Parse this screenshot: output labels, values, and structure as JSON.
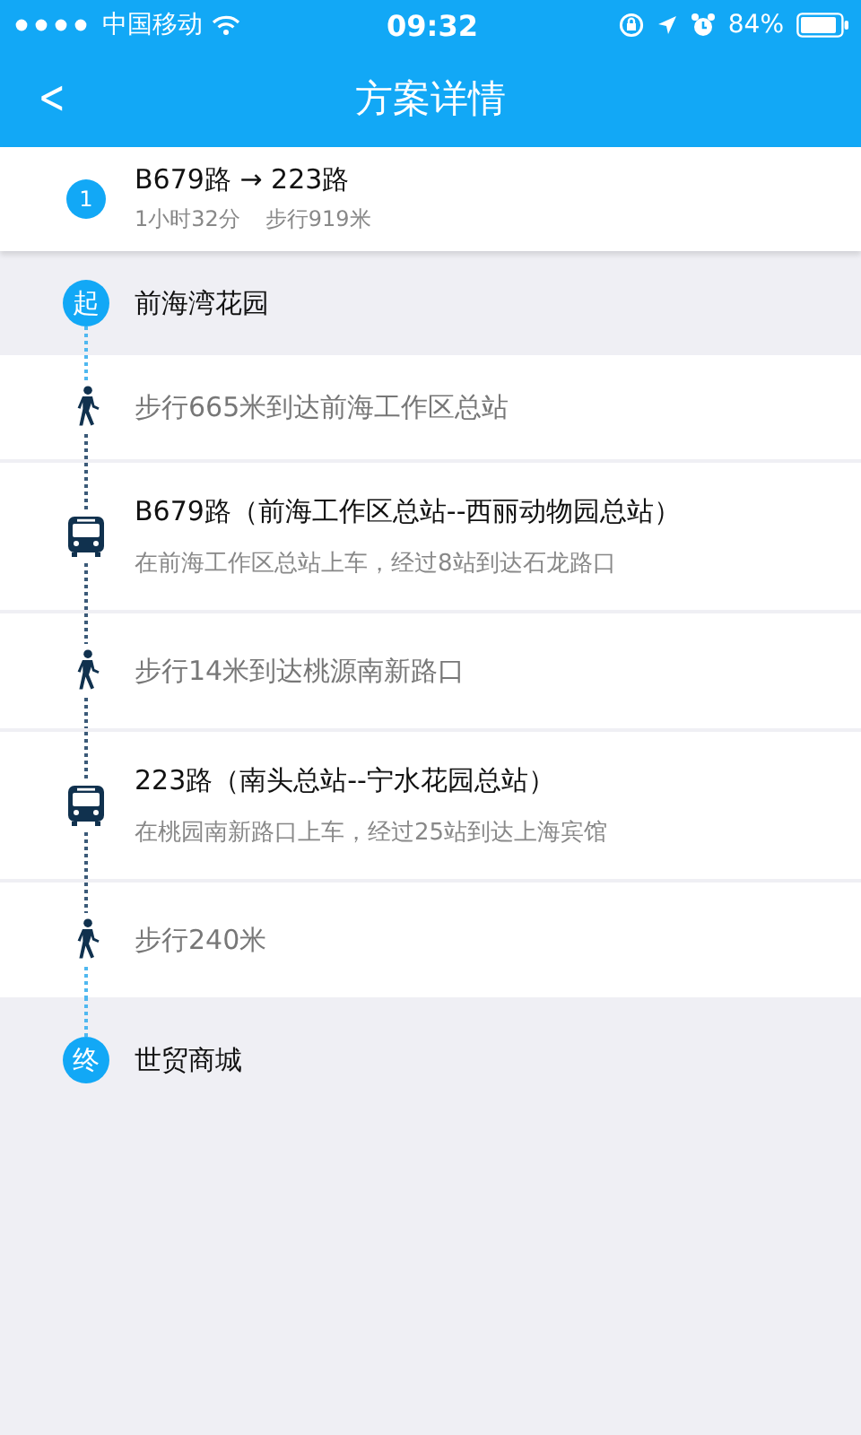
{
  "status_bar": {
    "carrier": "中国移动",
    "time": "09:32",
    "battery": "84%"
  },
  "nav": {
    "back": "<",
    "title": "方案详情"
  },
  "summary": {
    "index": "1",
    "route": "B679路 → 223路",
    "duration": "1小时32分",
    "walk": "步行919米"
  },
  "steps": [
    {
      "kind": "start",
      "badge": "起",
      "title": "前海湾花园"
    },
    {
      "kind": "walk",
      "text": "步行665米到达前海工作区总站"
    },
    {
      "kind": "bus",
      "title": "B679路（前海工作区总站--西丽动物园总站）",
      "detail": "在前海工作区总站上车，经过8站到达石龙路口"
    },
    {
      "kind": "walk",
      "text": "步行14米到达桃源南新路口"
    },
    {
      "kind": "bus",
      "title": "223路（南头总站--宁水花园总站）",
      "detail": "在桃园南新路口上车，经过25站到达上海宾馆"
    },
    {
      "kind": "walk",
      "text": "步行240米"
    },
    {
      "kind": "end",
      "badge": "终",
      "title": "世贸商城"
    }
  ]
}
